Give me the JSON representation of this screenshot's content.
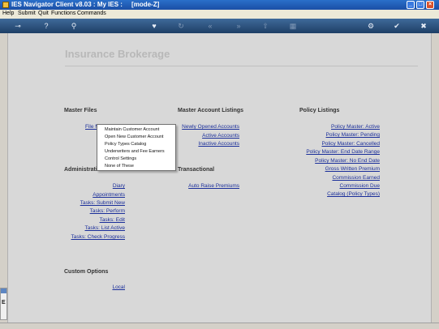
{
  "window": {
    "title": "IES Navigator Client v8.03 : My IES :     [mode-Z]",
    "controls": [
      "minimize",
      "maximize",
      "close"
    ]
  },
  "menu": [
    "Help",
    "Submit",
    "Quit",
    "Functions",
    "Commands"
  ],
  "toolbar": {
    "icons": [
      "key-icon",
      "help-icon",
      "search-icon",
      "heart-icon",
      "refresh-icon",
      "rewind-icon",
      "fast-forward-icon",
      "upload-icon",
      "grid-icon",
      "settings-icon",
      "check-icon",
      "close-icon"
    ]
  },
  "page": {
    "title": "Insurance Brokerage"
  },
  "master_files": {
    "title": "Master Files",
    "link": "File Maintenance",
    "dropdown": [
      "Maintain Customer Account",
      "Open New Customer Account",
      "Policy Types Catalog",
      "Underwriters and Fee Earners",
      "Control Settings",
      "None of These"
    ]
  },
  "master_account_listings": {
    "title": "Master Account Listings",
    "links": [
      "Newly Opened Accounts",
      "Active Accounts",
      "Inactive Accounts"
    ]
  },
  "policy_listings": {
    "title": "Policy Listings",
    "links": [
      "Policy Master: Active",
      "Policy Master: Pending",
      "Policy Master: Cancelled",
      "Policy Master: End Date Range",
      "Policy Master: No End Date",
      "Gross Written Premium",
      "Commission Earned",
      "Commission Due",
      "Catalog (Policy Types)"
    ]
  },
  "administration": {
    "title": "Administration",
    "links": [
      "Diary",
      "Appointments",
      "Tasks: Submit New",
      "Tasks: Perform",
      "Tasks: Edit",
      "Tasks: List Active",
      "Tasks: Check Progress"
    ]
  },
  "transactional": {
    "title": "Transactional",
    "links": [
      "Auto Raise Premiums"
    ]
  },
  "custom_options": {
    "title": "Custom Options",
    "links": [
      "Local"
    ]
  },
  "side_strip": {
    "glyph": "E"
  }
}
